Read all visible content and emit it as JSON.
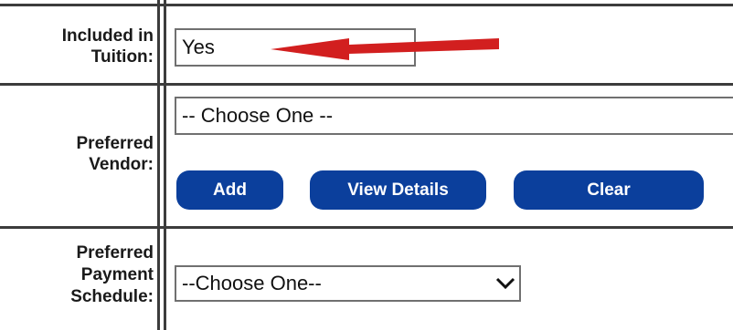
{
  "rows": {
    "tuition": {
      "label_line1": "Included in",
      "label_line2": "Tuition:",
      "selected": "Yes"
    },
    "vendor": {
      "label_line1": "Preferred",
      "label_line2": "Vendor:",
      "selected": "-- Choose One --",
      "buttons": {
        "add": "Add",
        "view_details": "View Details",
        "clear": "Clear"
      }
    },
    "payment": {
      "label_line1": "Preferred",
      "label_line2": "Payment",
      "label_line3": "Schedule:",
      "selected": "--Choose One--"
    }
  },
  "colors": {
    "button_bg": "#0b3f9c",
    "arrow": "#d21f1f",
    "border": "#3c3c3c"
  },
  "icons": {
    "dropdown": "chevron-down-icon",
    "annotation": "red-arrow-icon"
  }
}
